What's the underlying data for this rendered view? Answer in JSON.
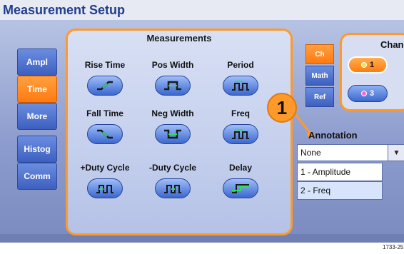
{
  "title": "Measurement Setup",
  "side_tabs": [
    "Ampl",
    "Time",
    "More",
    "Histog",
    "Comm"
  ],
  "measurements": {
    "title": "Measurements",
    "items": [
      {
        "label": "Rise Time",
        "icon": "rise-time-icon"
      },
      {
        "label": "Pos Width",
        "icon": "pos-width-icon"
      },
      {
        "label": "Period",
        "icon": "period-icon"
      },
      {
        "label": "Fall Time",
        "icon": "fall-time-icon"
      },
      {
        "label": "Neg Width",
        "icon": "neg-width-icon"
      },
      {
        "label": "Freq",
        "icon": "freq-icon"
      },
      {
        "label": "+Duty Cycle",
        "icon": "pos-duty-cycle-icon"
      },
      {
        "label": "-Duty Cycle",
        "icon": "neg-duty-cycle-icon"
      },
      {
        "label": "Delay",
        "icon": "delay-icon"
      }
    ]
  },
  "source_tabs": [
    "Ch",
    "Math",
    "Ref"
  ],
  "channels": {
    "title": "Chan",
    "ch1": "1",
    "ch3": "3",
    "ch1_color": "#f2e44a",
    "ch3_color": "#ff66cc"
  },
  "callout": "1",
  "annotation": {
    "label": "Annotation",
    "value": "None",
    "options": [
      "1 - Amplitude",
      "2 - Freq"
    ]
  },
  "figure_id": "1733-25",
  "colors": {
    "accent": "#ff9a2a",
    "button_blue": "#3d60c0",
    "title": "#1f3e8c"
  }
}
